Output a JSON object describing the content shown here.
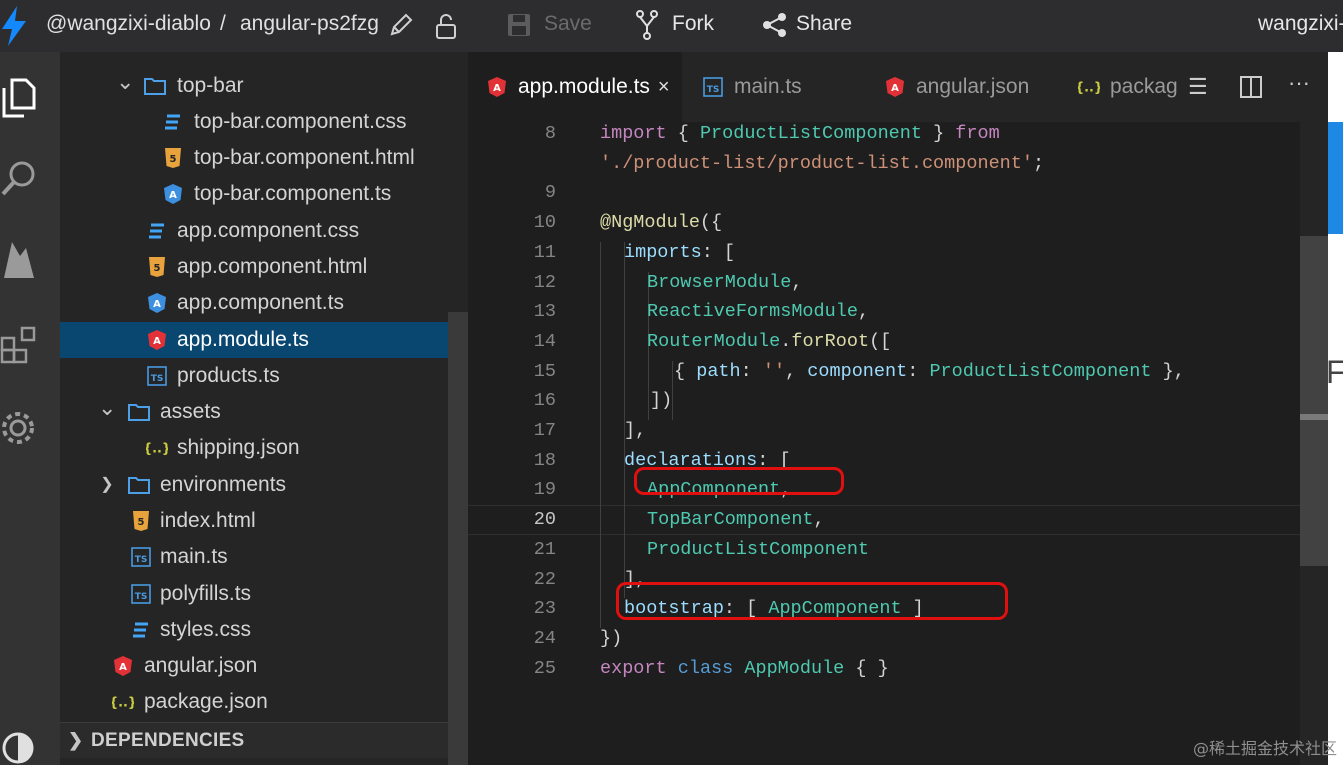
{
  "topbar": {
    "user": "@wangzixi-diablo",
    "separator": "/",
    "project": "angular-ps2fzg",
    "save_label": "Save",
    "fork_label": "Fork",
    "share_label": "Share",
    "account": "wangzixi-"
  },
  "explorer": {
    "items": [
      {
        "label": "top-bar",
        "icon": "folder-icon"
      },
      {
        "label": "top-bar.component.css",
        "icon": "css-file-icon"
      },
      {
        "label": "top-bar.component.html",
        "icon": "html-file-icon"
      },
      {
        "label": "top-bar.component.ts",
        "icon": "angular-file-icon"
      },
      {
        "label": "app.component.css",
        "icon": "css-file-icon"
      },
      {
        "label": "app.component.html",
        "icon": "html-file-icon"
      },
      {
        "label": "app.component.ts",
        "icon": "angular-file-icon"
      },
      {
        "label": "app.module.ts",
        "icon": "angular-module-icon",
        "selected": true
      },
      {
        "label": "products.ts",
        "icon": "ts-file-icon"
      },
      {
        "label": "assets",
        "icon": "folder-icon"
      },
      {
        "label": "shipping.json",
        "icon": "json-file-icon"
      },
      {
        "label": "environments",
        "icon": "folder-icon"
      },
      {
        "label": "index.html",
        "icon": "html-file-icon"
      },
      {
        "label": "main.ts",
        "icon": "ts-file-icon"
      },
      {
        "label": "polyfills.ts",
        "icon": "ts-file-icon"
      },
      {
        "label": "styles.css",
        "icon": "css-file-icon"
      },
      {
        "label": "angular.json",
        "icon": "angular-config-icon"
      },
      {
        "label": "package.json",
        "icon": "json-file-icon"
      }
    ],
    "dependencies_label": "DEPENDENCIES"
  },
  "tabs": [
    {
      "label": "app.module.ts",
      "active": true,
      "icon": "angular-module-icon"
    },
    {
      "label": "main.ts",
      "icon": "ts-file-icon"
    },
    {
      "label": "angular.json",
      "icon": "angular-config-icon"
    },
    {
      "label": "packag",
      "icon": "json-file-icon"
    }
  ],
  "tab_close": "×",
  "code": {
    "current_line": 20,
    "lines": [
      {
        "n": "8"
      },
      {
        "n": ""
      },
      {
        "n": "9"
      },
      {
        "n": "10"
      },
      {
        "n": "11"
      },
      {
        "n": "12"
      },
      {
        "n": "13"
      },
      {
        "n": "14"
      },
      {
        "n": "15"
      },
      {
        "n": "16"
      },
      {
        "n": "17"
      },
      {
        "n": "18"
      },
      {
        "n": "19"
      },
      {
        "n": "20"
      },
      {
        "n": "21"
      },
      {
        "n": "22"
      },
      {
        "n": "23"
      },
      {
        "n": "24"
      },
      {
        "n": "25"
      }
    ],
    "tokens": {
      "l8a": "import",
      "l8b": " { ",
      "l8c": "ProductListComponent",
      "l8d": " } ",
      "l8e": "from",
      "l8f": "'./product-list/product-list.component'",
      "l8g": ";",
      "l10a": "@NgModule",
      "l10b": "({",
      "l11a": "imports",
      "l11b": ": [",
      "l12a": "BrowserModule",
      "l12b": ",",
      "l13a": "ReactiveFormsModule",
      "l13b": ",",
      "l14a": "RouterModule",
      "l14b": ".",
      "l14c": "forRoot",
      "l14d": "([",
      "l15a": "{ ",
      "l15b": "path",
      "l15c": ": ",
      "l15d": "''",
      "l15e": ", ",
      "l15f": "component",
      "l15g": ": ",
      "l15h": "ProductListComponent",
      "l15i": " },",
      "l16a": "])",
      "l17a": "],",
      "l18a": "declarations",
      "l18b": ": [",
      "l19a": "AppComponent",
      "l19b": ",",
      "l20a": "TopBarComponent",
      "l20b": ",",
      "l21a": "ProductListComponent",
      "l22a": "],",
      "l23a": "bootstrap",
      "l23b": ": [ ",
      "l23c": "AppComponent",
      "l23d": " ]",
      "l24a": "})",
      "l25a": "export",
      "l25b": " ",
      "l25c": "class",
      "l25d": " ",
      "l25e": "AppModule",
      "l25f": " { }"
    }
  },
  "preview_char": "F",
  "watermark": "@稀土掘金技术社区",
  "colors": {
    "selection": "#094771",
    "highlight_box": "#e01010",
    "preview_accent": "#1e88e5"
  }
}
